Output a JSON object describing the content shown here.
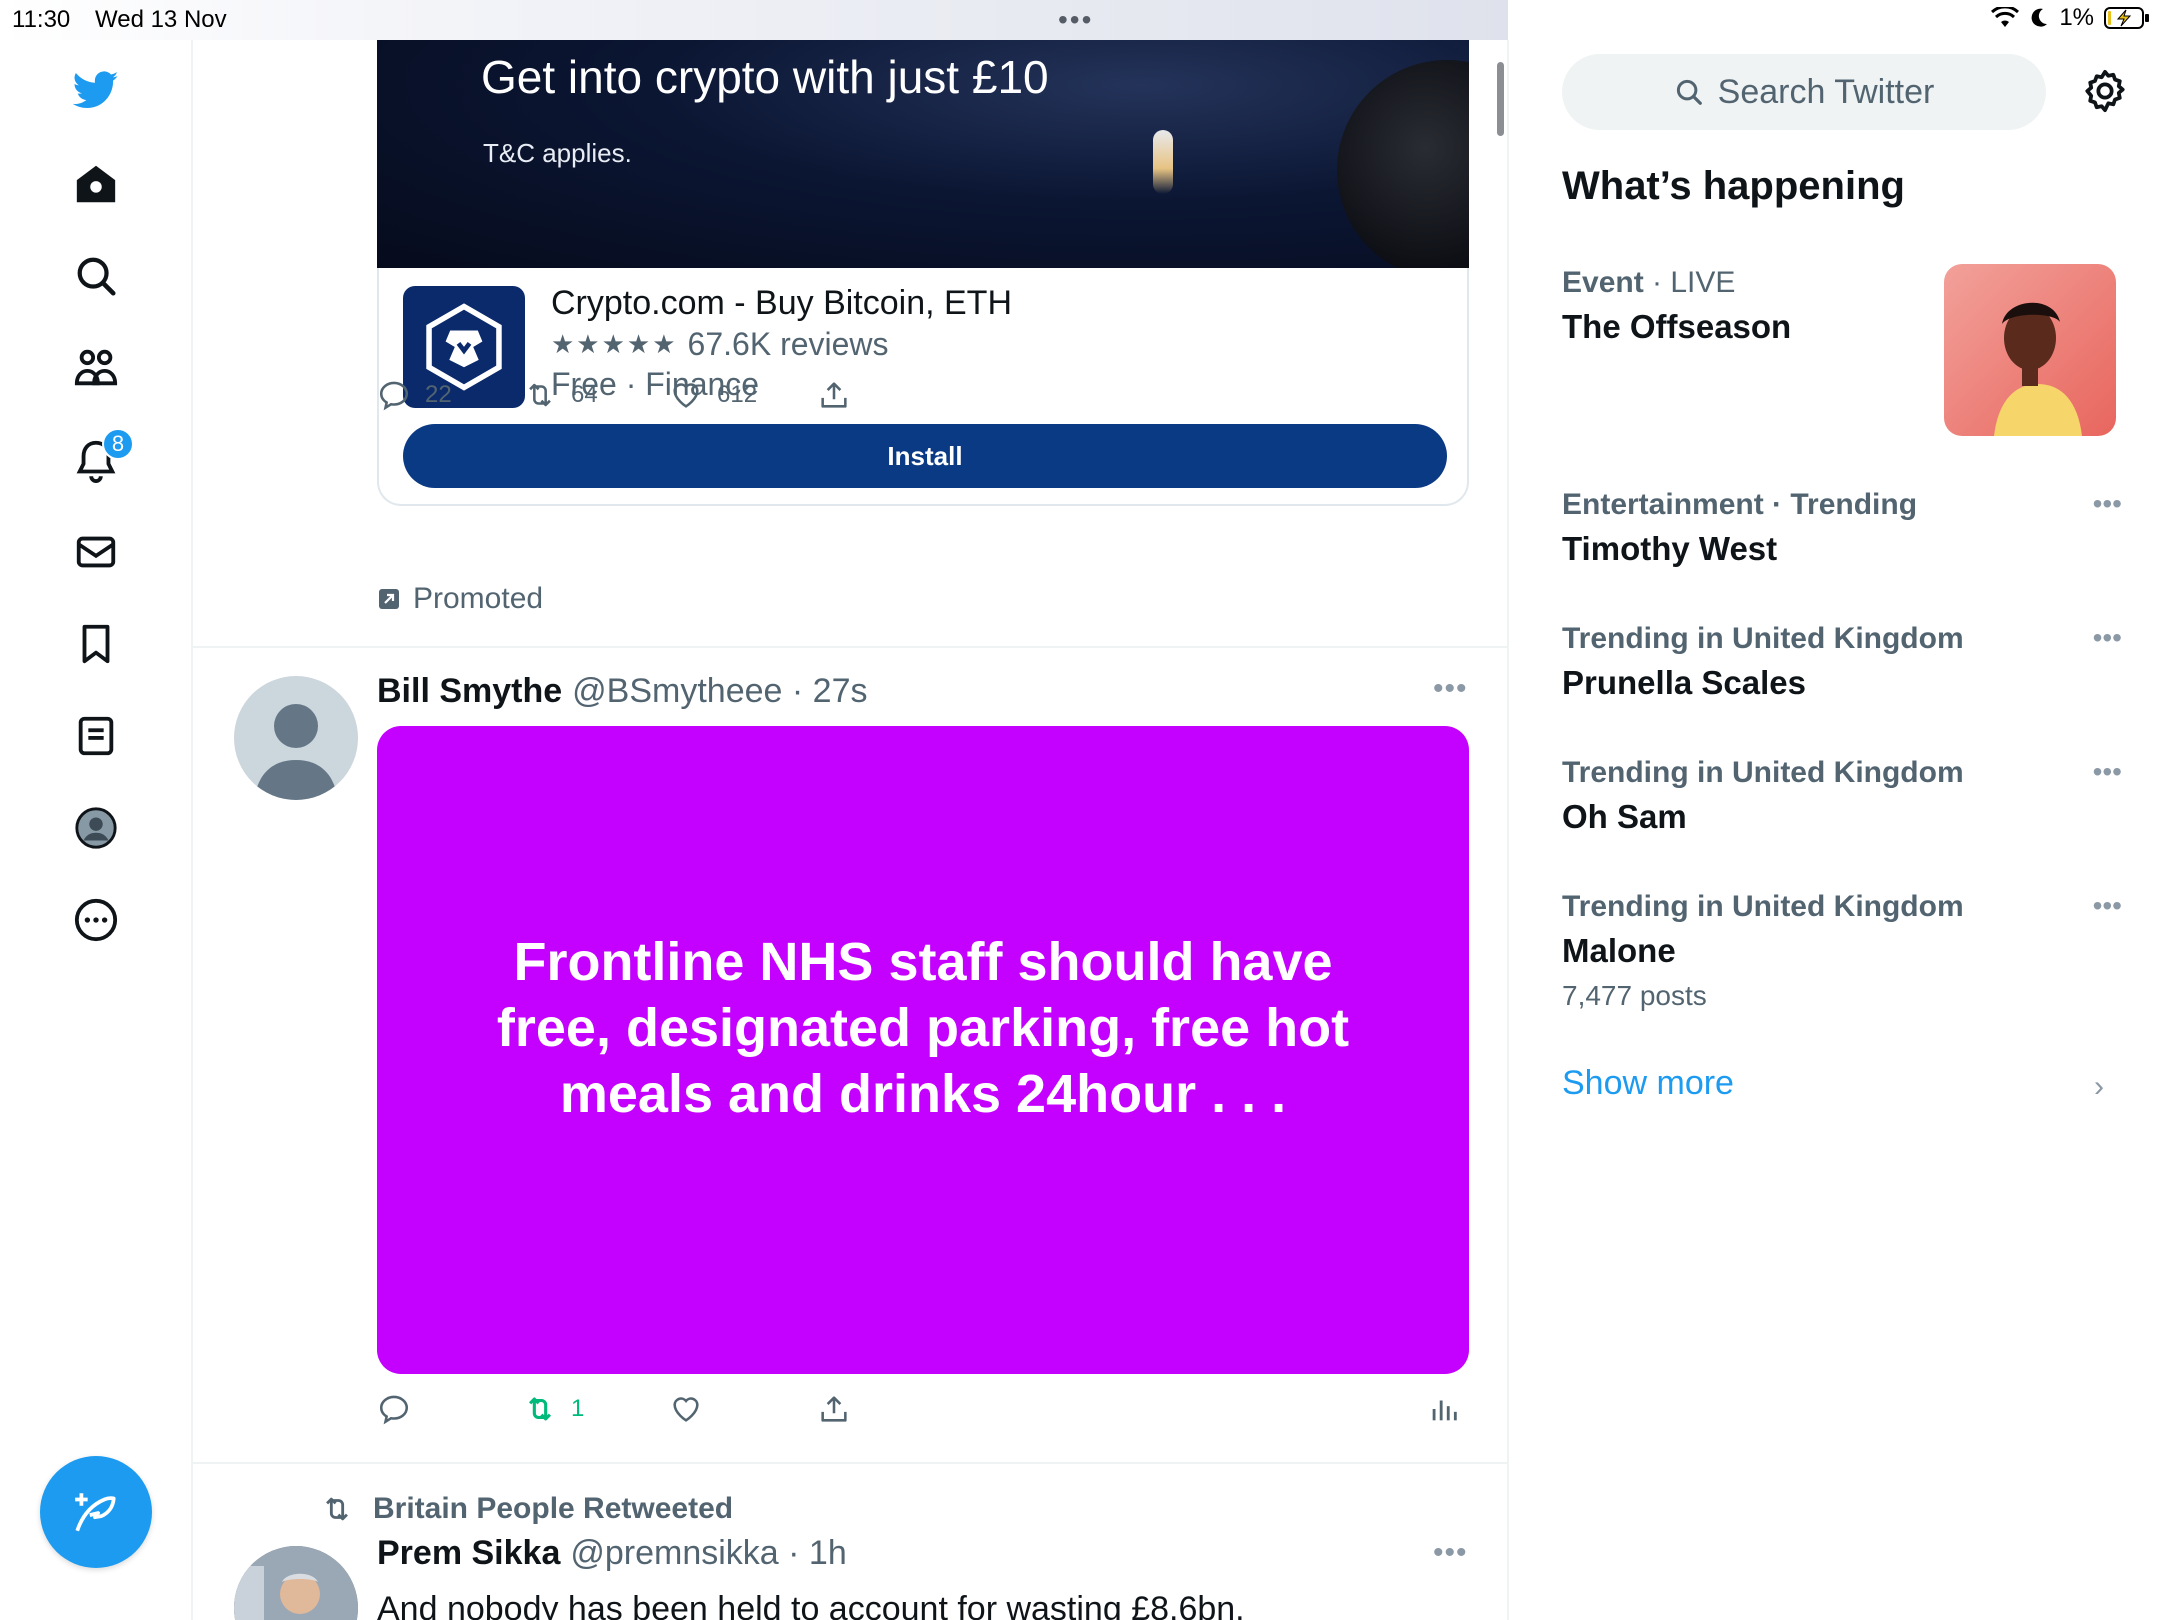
{
  "status_bar": {
    "time": "11:30",
    "date": "Wed 13 Nov",
    "battery": "1%"
  },
  "nav": {
    "notifications_badge": "8"
  },
  "ad": {
    "headline": "Get into crypto with just £10",
    "terms": "T&C applies.",
    "app_name": "Crypto.com - Buy Bitcoin, ETH",
    "stars": "★★★★★",
    "reviews": "67.6K reviews",
    "meta": "Free · Finance",
    "install_label": "Install",
    "replies": "22",
    "retweets": "64",
    "likes": "612",
    "promoted_label": "Promoted"
  },
  "tweet1": {
    "name": "Bill Smythe",
    "handle": "@BSmytheee · 27s",
    "image_text": "Frontline NHS staff should have free, designated parking, free hot meals and drinks 24hour . . .",
    "retweets": "1"
  },
  "tweet2": {
    "retweeted_by": "Britain People Retweeted",
    "name": "Prem Sikka",
    "handle": "@premnsikka · 1h",
    "text": "And nobody has been held to account for wasting £8.6bn."
  },
  "sidebar": {
    "search_placeholder": "Search Twitter",
    "title": "What’s happening",
    "trends": [
      {
        "context_bold": "Event",
        "context_rest": " · LIVE",
        "name": "The Offseason",
        "posts": ""
      },
      {
        "context_bold": "Entertainment · Trending",
        "context_rest": "",
        "name": "Timothy West",
        "posts": ""
      },
      {
        "context_bold": "Trending in United Kingdom",
        "context_rest": "",
        "name": "Prunella Scales",
        "posts": ""
      },
      {
        "context_bold": "Trending in United Kingdom",
        "context_rest": "",
        "name": "Oh Sam",
        "posts": ""
      },
      {
        "context_bold": "Trending in United Kingdom",
        "context_rest": "",
        "name": "Malone",
        "posts": "7,477 posts"
      }
    ],
    "show_more": "Show more"
  },
  "colors": {
    "brand_blue": "#1d9bf0",
    "install_blue": "#0b3a84",
    "card_purple": "#c400ff",
    "retweet_green": "#00ba7c"
  },
  "icons": [
    "twitter-logo-icon",
    "home-icon",
    "search-icon",
    "communities-icon",
    "notifications-icon",
    "messages-icon",
    "bookmarks-icon",
    "lists-icon",
    "profile-icon",
    "more-icon",
    "compose-icon",
    "reply-icon",
    "retweet-icon",
    "like-icon",
    "share-icon",
    "analytics-icon",
    "gear-icon",
    "chevron-right-icon"
  ]
}
